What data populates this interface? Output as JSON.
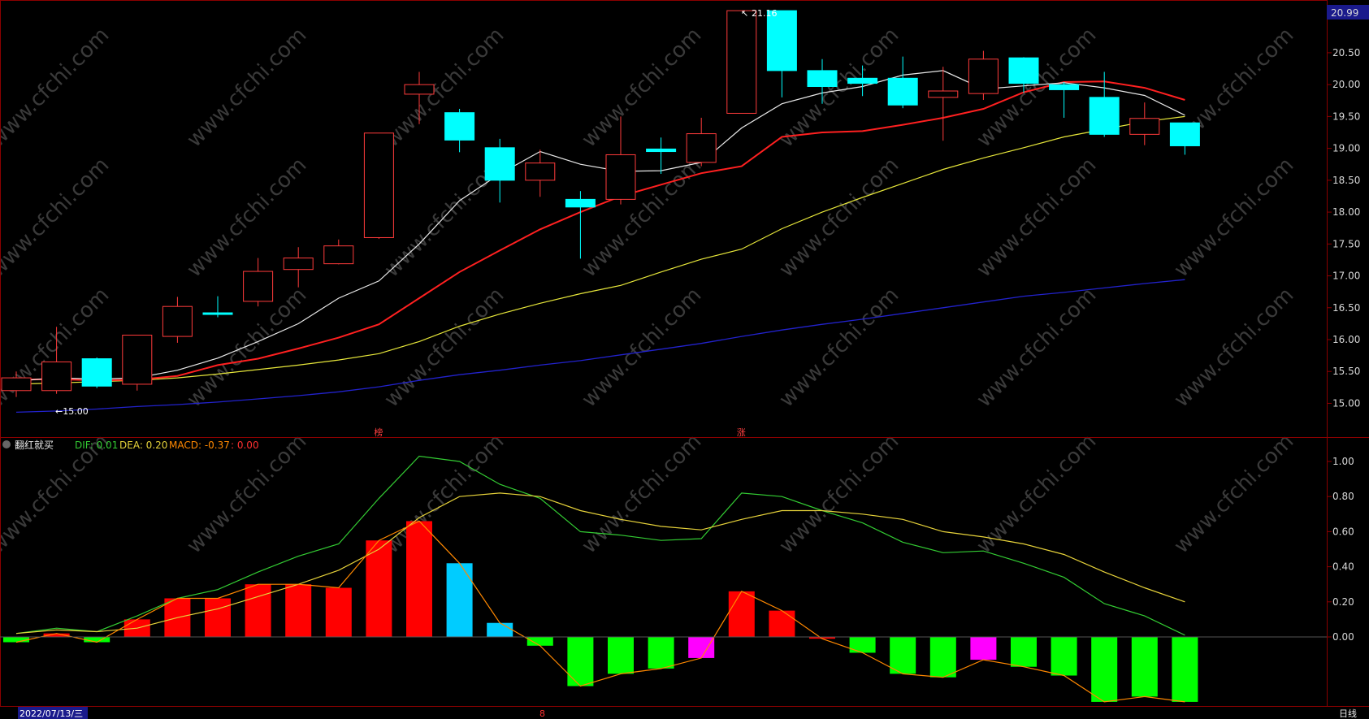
{
  "window": {
    "bottom_left_label": "2022/07/13/三",
    "bottom_right_label": "日线",
    "bottom_marker": "8"
  },
  "watermark": "www.cfchi.com",
  "price_panel": {
    "current_price_label": "20.99",
    "high_annotation": "21.16",
    "low_annotation": "←15.00",
    "y_ticks": [
      "20.50",
      "20.00",
      "19.50",
      "19.00",
      "18.50",
      "18.00",
      "17.50",
      "17.00",
      "16.50",
      "16.00",
      "15.50",
      "15.00"
    ],
    "markers": [
      {
        "idx": 9,
        "text": "榜"
      },
      {
        "idx": 18,
        "text": "涨"
      }
    ]
  },
  "macd_panel": {
    "title": "翻红就买",
    "dif_label": "DIF: 0.01",
    "dea_label": "DEA: 0.20",
    "macd_label": "MACD: -0.37",
    "extra_label": ": 0.00",
    "y_ticks": [
      "1.00",
      "0.80",
      "0.60",
      "0.40",
      "0.20",
      "0.00"
    ]
  },
  "colors": {
    "up": "#ff3b3b",
    "down": "#00ffff",
    "ma5": "#e8e8e8",
    "ma10": "#ff2020",
    "ma20": "#e6e63a",
    "ma60": "#2222cc",
    "dif": "#33cc33",
    "dea": "#e6d23a",
    "macd_line": "#ff8800",
    "bar_red": "#ff0000",
    "bar_green": "#00ff00",
    "bar_cyan": "#00ccff",
    "bar_magenta": "#ff00ff",
    "grid": "#8b0000",
    "axis_label_bg": "#1a1a8c"
  },
  "chart_data": [
    {
      "type": "candlestick",
      "candles": [
        {
          "o": 15.2,
          "c": 15.4,
          "h": 15.5,
          "l": 15.1
        },
        {
          "o": 15.2,
          "c": 15.65,
          "h": 16.2,
          "l": 15.15
        },
        {
          "o": 15.7,
          "c": 15.27,
          "h": 15.72,
          "l": 15.24
        },
        {
          "o": 15.3,
          "c": 16.07,
          "h": 16.07,
          "l": 15.2
        },
        {
          "o": 16.05,
          "c": 16.52,
          "h": 16.67,
          "l": 15.95
        },
        {
          "o": 16.42,
          "c": 16.4,
          "h": 16.68,
          "l": 16.35
        },
        {
          "o": 16.6,
          "c": 17.07,
          "h": 17.28,
          "l": 16.52
        },
        {
          "o": 17.1,
          "c": 17.28,
          "h": 17.45,
          "l": 16.82
        },
        {
          "o": 17.19,
          "c": 17.47,
          "h": 17.57,
          "l": 17.18
        },
        {
          "o": 17.6,
          "c": 19.24,
          "h": 19.24,
          "l": 17.58
        },
        {
          "o": 19.85,
          "c": 20.0,
          "h": 20.2,
          "l": 19.38
        },
        {
          "o": 19.56,
          "c": 19.13,
          "h": 19.62,
          "l": 18.94
        },
        {
          "o": 19.01,
          "c": 18.5,
          "h": 19.15,
          "l": 18.15
        },
        {
          "o": 18.5,
          "c": 18.77,
          "h": 18.98,
          "l": 18.24
        },
        {
          "o": 18.2,
          "c": 18.08,
          "h": 18.33,
          "l": 17.27
        },
        {
          "o": 18.2,
          "c": 18.9,
          "h": 19.5,
          "l": 18.12
        },
        {
          "o": 18.99,
          "c": 18.95,
          "h": 19.17,
          "l": 18.6
        },
        {
          "o": 18.78,
          "c": 19.23,
          "h": 19.48,
          "l": 18.72
        },
        {
          "o": 19.55,
          "c": 21.16,
          "h": 21.16,
          "l": 19.55
        },
        {
          "o": 21.16,
          "c": 20.22,
          "h": 21.16,
          "l": 19.8
        },
        {
          "o": 20.22,
          "c": 19.97,
          "h": 20.4,
          "l": 19.7
        },
        {
          "o": 20.1,
          "c": 20.02,
          "h": 20.3,
          "l": 19.82
        },
        {
          "o": 20.1,
          "c": 19.68,
          "h": 20.44,
          "l": 19.63
        },
        {
          "o": 19.8,
          "c": 19.9,
          "h": 20.28,
          "l": 19.12
        },
        {
          "o": 19.86,
          "c": 20.4,
          "h": 20.53,
          "l": 19.76
        },
        {
          "o": 20.42,
          "c": 20.02,
          "h": 20.43,
          "l": 19.87
        },
        {
          "o": 20.0,
          "c": 19.92,
          "h": 20.04,
          "l": 19.48
        },
        {
          "o": 19.8,
          "c": 19.22,
          "h": 20.2,
          "l": 19.18
        },
        {
          "o": 19.22,
          "c": 19.47,
          "h": 19.72,
          "l": 19.05
        },
        {
          "o": 19.4,
          "c": 19.04,
          "h": 19.4,
          "l": 18.9
        }
      ],
      "ma5": [
        15.35,
        15.4,
        15.38,
        15.4,
        15.52,
        15.71,
        15.97,
        16.25,
        16.65,
        16.92,
        17.5,
        18.18,
        18.6,
        18.95,
        18.75,
        18.64,
        18.65,
        18.78,
        19.32,
        19.7,
        19.87,
        19.97,
        20.15,
        20.22,
        19.93,
        19.98,
        20.03,
        19.95,
        19.83,
        19.52
      ],
      "ma10": [
        15.37,
        15.38,
        15.36,
        15.37,
        15.43,
        15.6,
        15.7,
        15.86,
        16.03,
        16.24,
        16.65,
        17.06,
        17.4,
        17.73,
        18.0,
        18.25,
        18.43,
        18.61,
        18.72,
        19.18,
        19.25,
        19.27,
        19.37,
        19.48,
        19.62,
        19.88,
        20.04,
        20.05,
        19.95,
        19.76
      ],
      "ma20": [
        15.3,
        15.32,
        15.34,
        15.36,
        15.4,
        15.46,
        15.53,
        15.6,
        15.68,
        15.78,
        15.97,
        16.21,
        16.4,
        16.57,
        16.72,
        16.85,
        17.06,
        17.26,
        17.42,
        17.74,
        18.0,
        18.23,
        18.45,
        18.67,
        18.85,
        19.01,
        19.18,
        19.3,
        19.42,
        19.5
      ],
      "ma60": [
        14.86,
        14.88,
        14.91,
        14.95,
        14.98,
        15.02,
        15.07,
        15.12,
        15.18,
        15.26,
        15.36,
        15.45,
        15.52,
        15.6,
        15.67,
        15.76,
        15.85,
        15.94,
        16.05,
        16.15,
        16.24,
        16.32,
        16.41,
        16.5,
        16.59,
        16.68,
        16.74,
        16.81,
        16.88,
        16.94
      ]
    },
    {
      "type": "macd",
      "dif": [
        0.02,
        0.05,
        0.03,
        0.12,
        0.22,
        0.27,
        0.37,
        0.46,
        0.53,
        0.79,
        1.03,
        1.0,
        0.87,
        0.79,
        0.6,
        0.58,
        0.55,
        0.56,
        0.82,
        0.8,
        0.72,
        0.65,
        0.54,
        0.48,
        0.49,
        0.42,
        0.34,
        0.19,
        0.12,
        0.01
      ],
      "dea": [
        0.02,
        0.04,
        0.03,
        0.05,
        0.11,
        0.16,
        0.23,
        0.3,
        0.38,
        0.5,
        0.68,
        0.8,
        0.82,
        0.8,
        0.72,
        0.67,
        0.63,
        0.61,
        0.67,
        0.72,
        0.72,
        0.7,
        0.67,
        0.6,
        0.57,
        0.53,
        0.47,
        0.37,
        0.28,
        0.2
      ],
      "macd": [
        -0.03,
        0.02,
        -0.03,
        0.1,
        0.22,
        0.22,
        0.3,
        0.3,
        0.28,
        0.55,
        0.66,
        0.42,
        0.08,
        -0.05,
        -0.28,
        -0.21,
        -0.18,
        -0.12,
        0.26,
        0.15,
        -0.01,
        -0.09,
        -0.21,
        -0.23,
        -0.13,
        -0.17,
        -0.22,
        -0.37,
        -0.34,
        -0.37
      ],
      "bar_colors": [
        "green",
        "red",
        "green",
        "red",
        "red",
        "red",
        "red",
        "red",
        "red",
        "red",
        "red",
        "cyan",
        "cyan",
        "green",
        "green",
        "green",
        "green",
        "magenta",
        "red",
        "red",
        "red",
        "green",
        "green",
        "green",
        "magenta",
        "green",
        "green",
        "green",
        "green",
        "green"
      ],
      "ylim": [
        -0.4,
        1.1
      ]
    }
  ]
}
